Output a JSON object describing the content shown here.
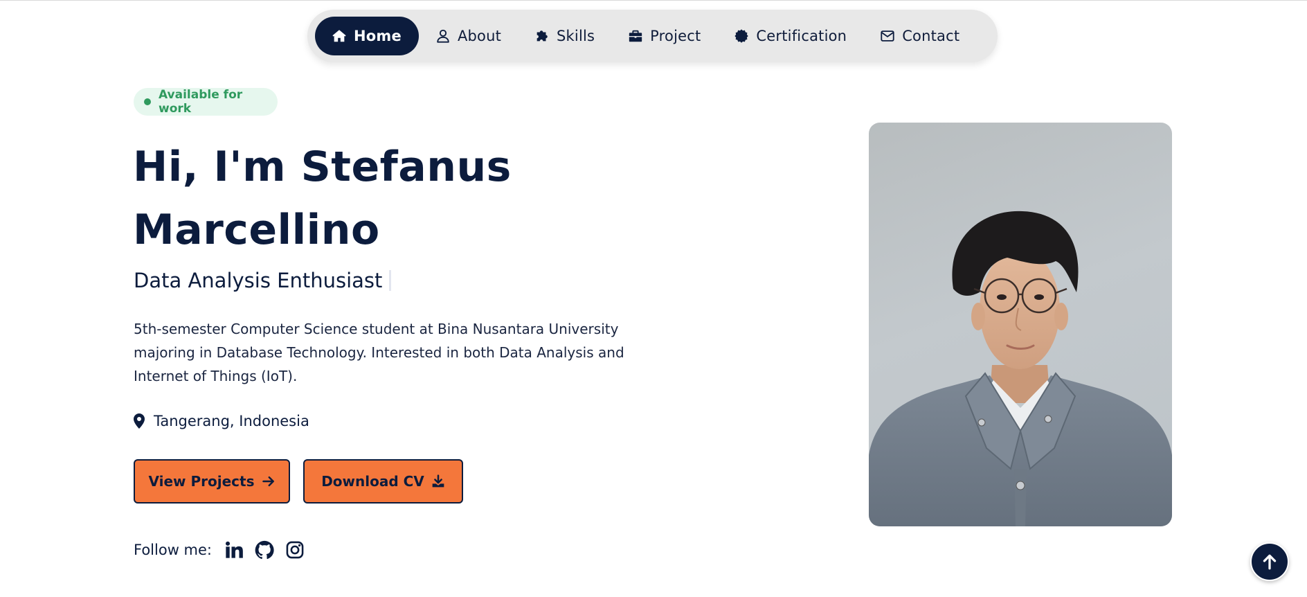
{
  "nav": {
    "items": [
      {
        "label": "Home",
        "icon": "home-icon",
        "active": true
      },
      {
        "label": "About",
        "icon": "user-icon"
      },
      {
        "label": "Skills",
        "icon": "puzzle-icon"
      },
      {
        "label": "Project",
        "icon": "briefcase-icon"
      },
      {
        "label": "Certification",
        "icon": "certificate-icon"
      },
      {
        "label": "Contact",
        "icon": "envelope-icon"
      }
    ]
  },
  "hero": {
    "badge": "Available for work",
    "title_line1": "Hi, I'm Stefanus",
    "title_line2": "Marcellino",
    "role": "Data Analysis Enthusiast",
    "bio": "5th-semester Computer Science student at Bina Nusantara University majoring in Database Technology. Interested in both Data Analysis and Internet of Things (IoT).",
    "location": "Tangerang, Indonesia",
    "buttons": {
      "projects": "View Projects",
      "cv": "Download CV"
    },
    "follow_label": "Follow me:",
    "socials": [
      "linkedin-icon",
      "github-icon",
      "instagram-icon"
    ]
  },
  "colors": {
    "navy": "#0c1c3d",
    "accent": "#f4773b",
    "badge_green": "#2f9a5e",
    "badge_bg": "#e6f7ee",
    "nav_bg": "#e8e8e8"
  }
}
